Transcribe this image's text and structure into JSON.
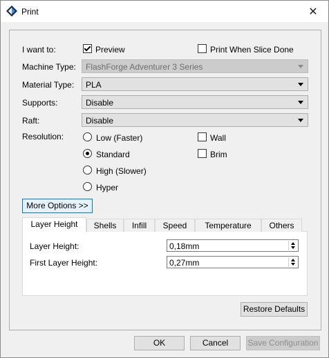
{
  "window": {
    "title": "Print",
    "close_glyph": "✕"
  },
  "form": {
    "i_want_to_label": "I want to:",
    "preview_label": "Preview",
    "preview_checked": true,
    "print_when_slice_done_label": "Print When Slice Done",
    "print_when_slice_done_checked": false,
    "machine_type_label": "Machine Type:",
    "machine_type_value": "FlashForge Adventurer 3 Series",
    "material_type_label": "Material Type:",
    "material_type_value": "PLA",
    "supports_label": "Supports:",
    "supports_value": "Disable",
    "raft_label": "Raft:",
    "raft_value": "Disable",
    "resolution_label": "Resolution:",
    "resolution_options": [
      "Low (Faster)",
      "Standard",
      "High (Slower)",
      "Hyper"
    ],
    "resolution_selected": "Standard",
    "wall_label": "Wall",
    "wall_checked": false,
    "brim_label": "Brim",
    "brim_checked": false,
    "more_options_label": "More Options >>"
  },
  "tabs": {
    "items": [
      "Layer Height",
      "Shells",
      "Infill",
      "Speed",
      "Temperature",
      "Others"
    ],
    "active": "Layer Height",
    "layer_height_label": "Layer Height:",
    "layer_height_value": "0,18mm",
    "first_layer_height_label": "First Layer Height:",
    "first_layer_height_value": "0,27mm"
  },
  "buttons": {
    "restore_defaults": "Restore Defaults",
    "ok": "OK",
    "cancel": "Cancel",
    "save_configuration": "Save Configuration"
  },
  "colors": {
    "focus_border": "#0078d7",
    "focus_fill": "#e5f1fb",
    "brand_icon_dark": "#1a2a5a",
    "brand_icon_blue": "#3a8ee6"
  }
}
